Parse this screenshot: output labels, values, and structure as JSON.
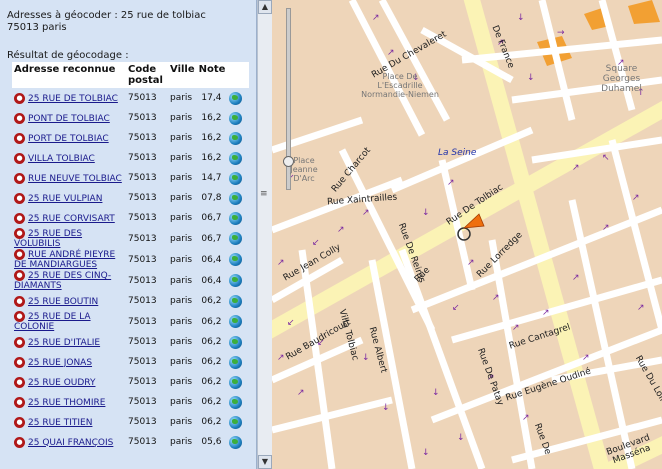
{
  "panel": {
    "title": "Adresses à géocoder : 25 rue de tolbiac",
    "subtitle": "75013 paris",
    "result_label": "Résultat de géocodage :",
    "columns": {
      "address": "Adresse reconnue",
      "postal": "Code postal",
      "city": "Ville",
      "note": "Note"
    },
    "rows": [
      {
        "address": "25 RUE DE TOLBIAC",
        "postal": "75013",
        "city": "paris",
        "note": "17,4"
      },
      {
        "address": "PONT DE TOLBIAC",
        "postal": "75013",
        "city": "paris",
        "note": "16,2"
      },
      {
        "address": "PORT DE TOLBIAC",
        "postal": "75013",
        "city": "paris",
        "note": "16,2"
      },
      {
        "address": "VILLA TOLBIAC",
        "postal": "75013",
        "city": "paris",
        "note": "16,2"
      },
      {
        "address": "RUE NEUVE TOLBIAC",
        "postal": "75013",
        "city": "paris",
        "note": "14,7"
      },
      {
        "address": "25 RUE VULPIAN",
        "postal": "75013",
        "city": "paris",
        "note": "07,8"
      },
      {
        "address": "25 RUE CORVISART",
        "postal": "75013",
        "city": "paris",
        "note": "06,7"
      },
      {
        "address": "25 RUE DES VOLUBILIS",
        "postal": "75013",
        "city": "paris",
        "note": "06,7"
      },
      {
        "address": "RUE ANDRÉ PIEYRE DE MANDIARGUES",
        "postal": "75013",
        "city": "paris",
        "note": "06,4"
      },
      {
        "address": "25 RUE DES CINQ-DIAMANTS",
        "postal": "75013",
        "city": "paris",
        "note": "06,4"
      },
      {
        "address": "25 RUE BOUTIN",
        "postal": "75013",
        "city": "paris",
        "note": "06,2"
      },
      {
        "address": "25 RUE DE LA COLONIE",
        "postal": "75013",
        "city": "paris",
        "note": "06,2"
      },
      {
        "address": "25 RUE D'ITALIE",
        "postal": "75013",
        "city": "paris",
        "note": "06,2"
      },
      {
        "address": "25 RUE JONAS",
        "postal": "75013",
        "city": "paris",
        "note": "06,2"
      },
      {
        "address": "25 RUE OUDRY",
        "postal": "75013",
        "city": "paris",
        "note": "06,2"
      },
      {
        "address": "25 RUE THOMIRE",
        "postal": "75013",
        "city": "paris",
        "note": "06,2"
      },
      {
        "address": "25 RUE TITIEN",
        "postal": "75013",
        "city": "paris",
        "note": "06,2"
      },
      {
        "address": "25 QUAI FRANÇOIS",
        "postal": "75013",
        "city": "paris",
        "note": "05,6"
      }
    ]
  },
  "scrollbar": {
    "up": "▲",
    "down": "▼",
    "grip": "≡"
  },
  "map": {
    "labels": {
      "de_france": "De France",
      "chevaleret": "Rue Du Chevaleret",
      "place_ecadrille": "Place De L'Escadrille Normandie-Niemen",
      "square": "Square Georges Duhamel",
      "la_seine": "La Seine",
      "place_jeanne": "Place Jeanne D'Arc",
      "rue_charcot": "Rue Charcot",
      "xaintrailles": "Rue Xaintrailles",
      "tolbiac": "Rue De Tolbiac",
      "de_reims": "Rue De Reims",
      "jean_colly": "Rue Jean Colly",
      "rue_lorredge": "Rue Lorredge",
      "baudricourt": "Rue Baudricourt",
      "villa": "Villa Tolbiac",
      "albert": "Rue Albert",
      "cantagrel": "Rue Cantagrel",
      "patay": "Rue De Patay",
      "oudine": "Rue Eugène Oudiné",
      "du_loiret": "Rue Du Loiret",
      "bd_massena": "Boulevard Masséna",
      "rue_de": "Rue De",
      "rue": "Rue"
    },
    "colors": {
      "block": "#eed5b9",
      "street": "#ffffff",
      "major": "#fbf3b5",
      "park": "#f2a033",
      "arrow": "#7b2aa0"
    }
  }
}
